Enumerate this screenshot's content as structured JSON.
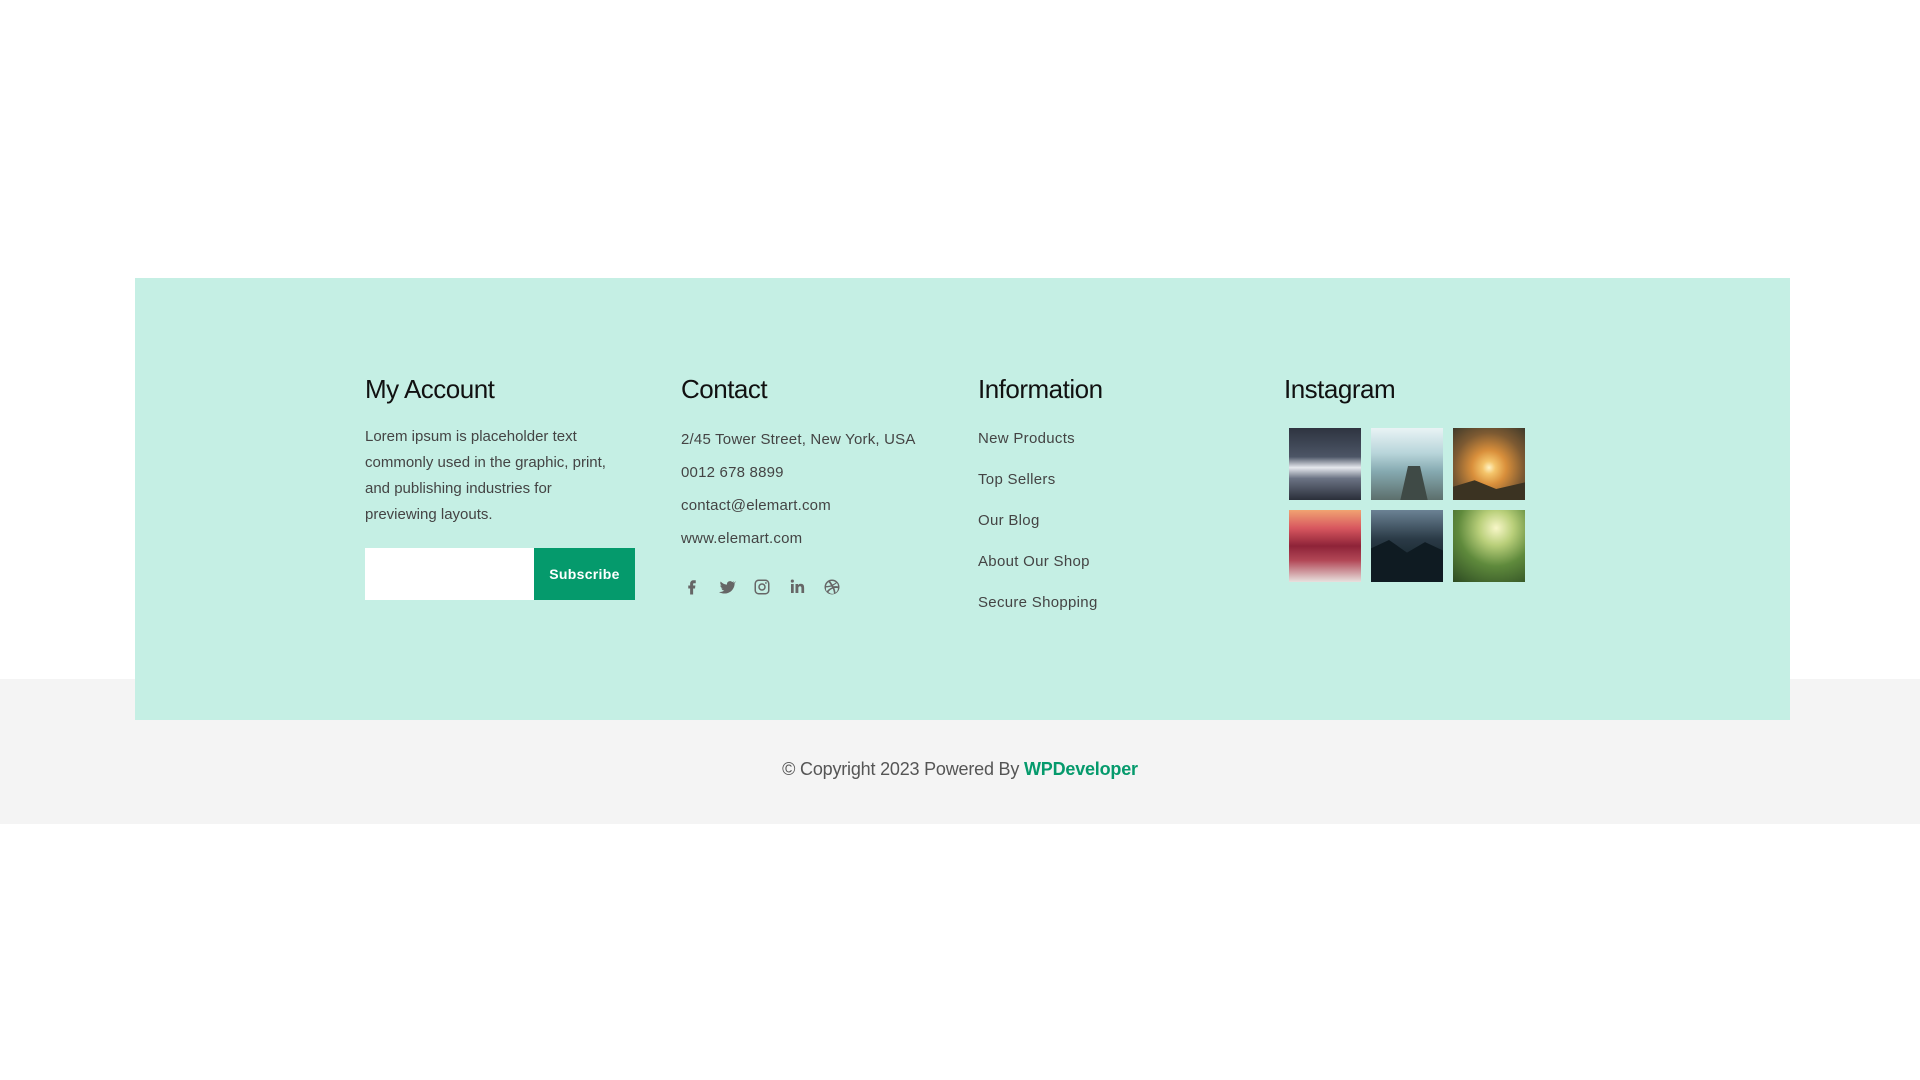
{
  "footer": {
    "my_account": {
      "title": "My Account",
      "text": "Lorem ipsum is placeholder text commonly used in the graphic, print, and publishing industries for previewing layouts.",
      "subscribe_input_value": "",
      "subscribe_label": "Subscribe"
    },
    "contact": {
      "title": "Contact",
      "address": "2/45 Tower Street, New York, USA",
      "phone": "0012 678 8899",
      "email": "contact@elemart.com",
      "website": "www.elemart.com",
      "social_icons": [
        "facebook-icon",
        "twitter-icon",
        "instagram-icon",
        "linkedin-icon",
        "dribbble-icon"
      ]
    },
    "information": {
      "title": "Information",
      "links": [
        "New Products",
        "Top Sellers",
        "Our Blog",
        "About Our Shop",
        "Secure Shopping"
      ]
    },
    "instagram": {
      "title": "Instagram",
      "images": [
        "snowy-mountain-photo",
        "hiker-on-cliff-photo",
        "sunset-over-hills-photo",
        "red-beach-sunset-photo",
        "dark-mountain-lake-photo",
        "sunlit-forest-photo"
      ]
    }
  },
  "copyright": {
    "text": "© Copyright 2023 Powered By",
    "link_label": "WPDeveloper"
  },
  "colors": {
    "footer_background": "#c5efe4",
    "copyright_background": "#f4f4f4",
    "accent": "#059a6c"
  }
}
